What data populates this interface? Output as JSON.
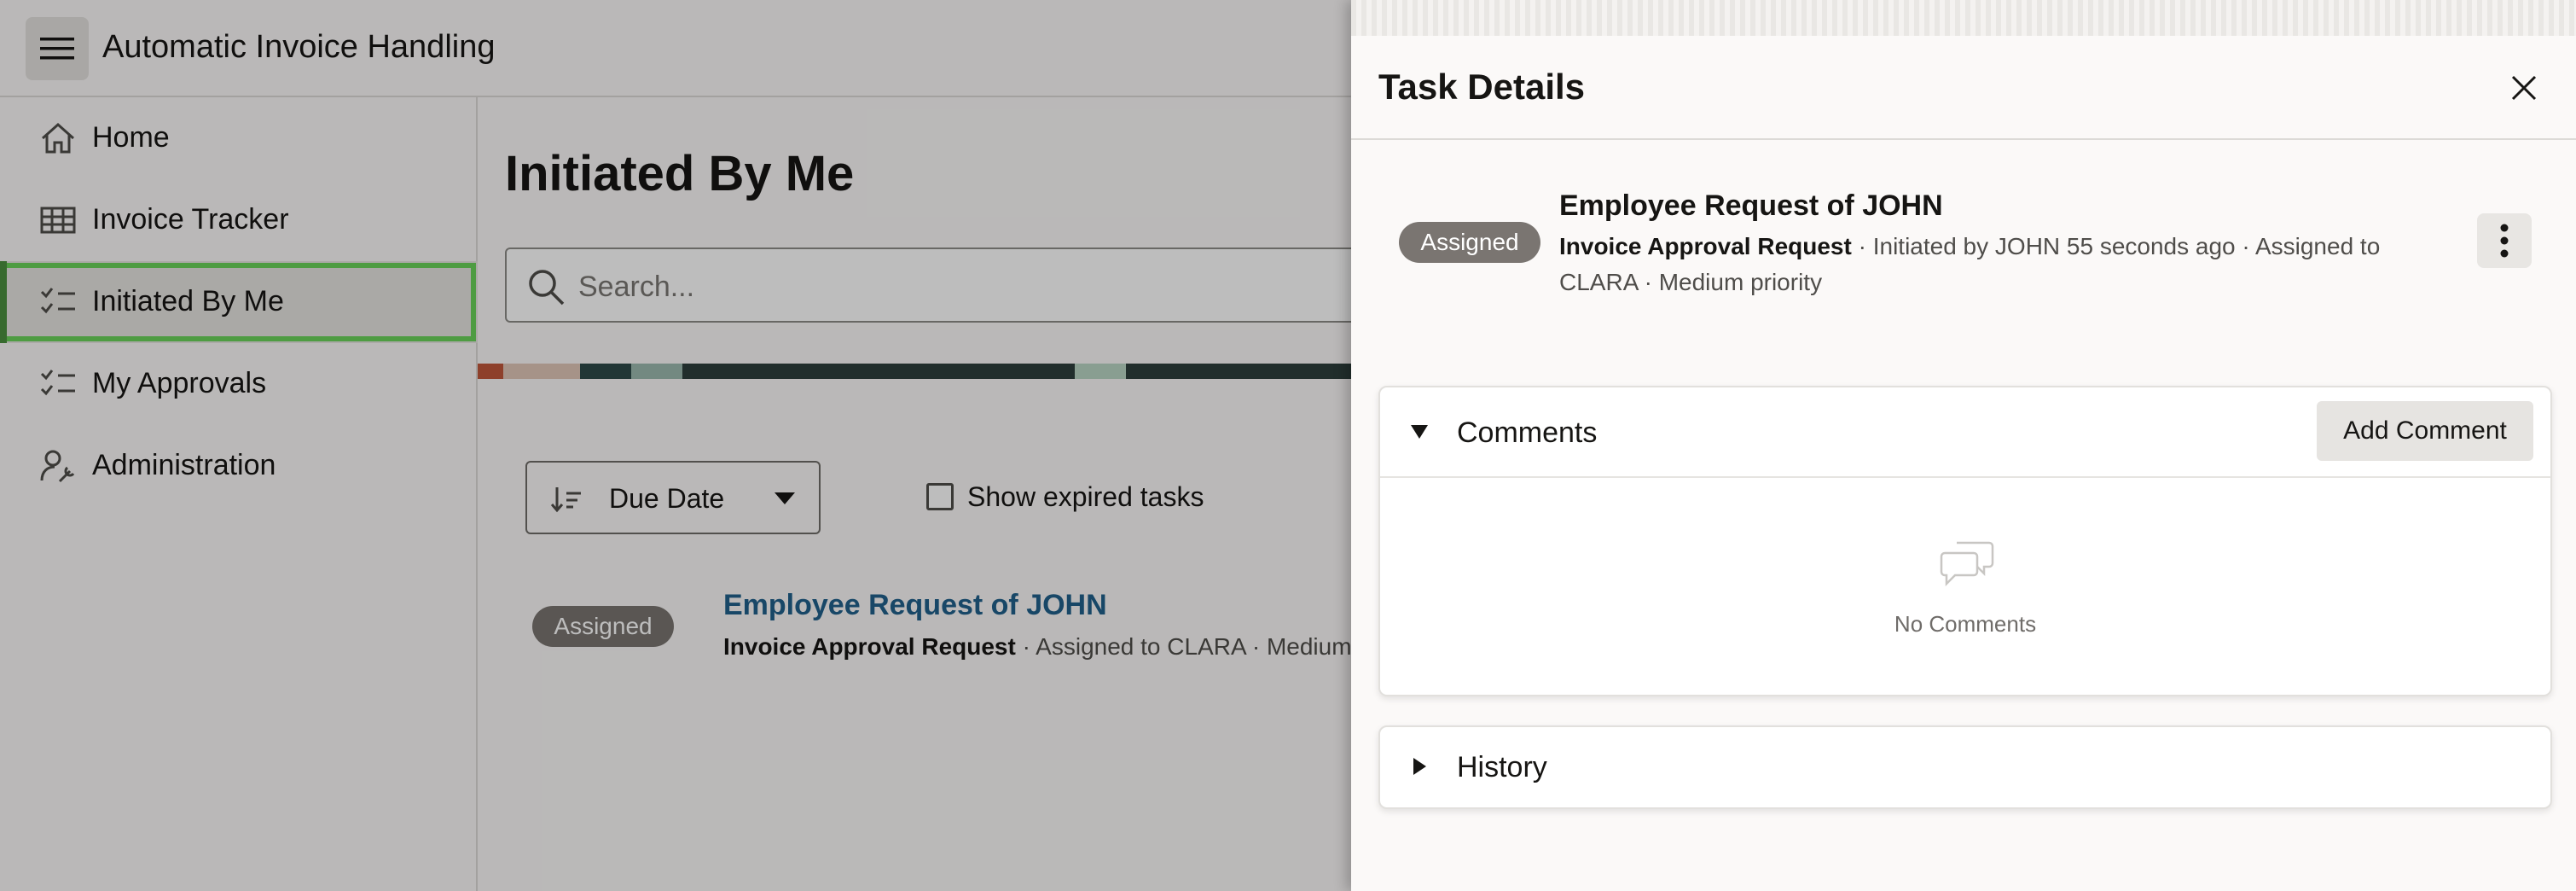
{
  "header": {
    "title": "Automatic Invoice Handling",
    "menu_icon": "hamburger-menu-icon"
  },
  "sidebar": {
    "items": [
      {
        "label": "Home",
        "icon": "home-icon",
        "active": false
      },
      {
        "label": "Invoice Tracker",
        "icon": "table-grid-icon",
        "active": false
      },
      {
        "label": "Initiated By Me",
        "icon": "checklist-icon",
        "active": true
      },
      {
        "label": "My Approvals",
        "icon": "checklist-icon",
        "active": false
      },
      {
        "label": "Administration",
        "icon": "user-wrench-icon",
        "active": false
      }
    ]
  },
  "main": {
    "title": "Initiated By Me",
    "search": {
      "placeholder": "Search...",
      "value": ""
    },
    "sort": {
      "label": "Due Date",
      "icon": "sort-descending-icon"
    },
    "show_expired": {
      "label": "Show expired tasks",
      "checked": false
    },
    "tasks": [
      {
        "status": "Assigned",
        "title": "Employee Request of JOHN",
        "type": "Invoice Approval Request",
        "details": " · Assigned to CLARA · Medium"
      }
    ]
  },
  "drawer": {
    "title": "Task Details",
    "task": {
      "status": "Assigned",
      "title": "Employee Request of JOHN",
      "type": "Invoice Approval Request",
      "details": " · Initiated by JOHN 55 seconds ago · Assigned to CLARA · Medium priority"
    },
    "comments": {
      "title": "Comments",
      "add_label": "Add Comment",
      "empty_text": "No Comments",
      "expanded": true
    },
    "history": {
      "title": "History",
      "expanded": false
    }
  },
  "colors": {
    "accent_link": "#21618c",
    "active_outline": "#6ad35a",
    "badge": "#7a7571"
  }
}
